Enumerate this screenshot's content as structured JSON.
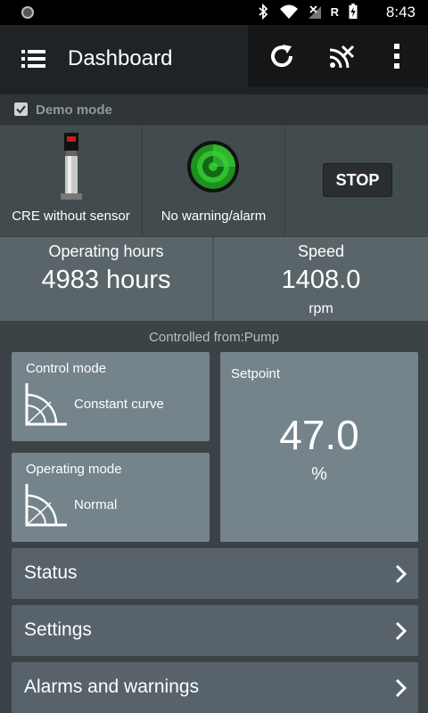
{
  "status_bar": {
    "time": "8:43",
    "icons": [
      "bluetooth-icon",
      "wifi-icon",
      "no-signal-icon",
      "roaming-icon",
      "battery-charging-icon"
    ],
    "roaming_letter": "R"
  },
  "app_bar": {
    "title": "Dashboard",
    "actions": [
      "refresh-icon",
      "disconnect-icon",
      "overflow-menu-icon"
    ]
  },
  "demo_mode": {
    "label": "Demo mode",
    "checked": true
  },
  "product": {
    "name": "CRE without sensor"
  },
  "alarm_status": {
    "label": "No warning/alarm"
  },
  "stop_button": {
    "label": "STOP"
  },
  "operating_hours": {
    "label": "Operating hours",
    "value": "4983 hours"
  },
  "speed": {
    "label": "Speed",
    "value": "1408.0",
    "unit": "rpm"
  },
  "controlled_from": "Controlled from:Pump",
  "control_mode": {
    "title": "Control mode",
    "value": "Constant curve"
  },
  "operating_mode": {
    "title": "Operating mode",
    "value": "Normal"
  },
  "setpoint": {
    "title": "Setpoint",
    "value": "47.0",
    "unit": "%"
  },
  "nav": [
    {
      "label": "Status"
    },
    {
      "label": "Settings"
    },
    {
      "label": "Alarms and warnings"
    }
  ],
  "colors": {
    "accent_green": "#2fbf2f",
    "background": "#3b4346"
  }
}
